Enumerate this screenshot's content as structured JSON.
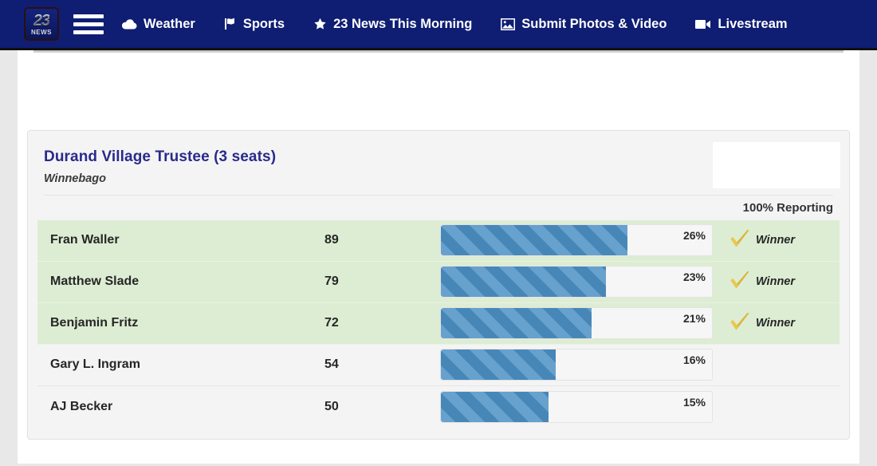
{
  "nav": {
    "logo": {
      "line1": "23",
      "line2": "NEWS",
      "name": "23-news-logo"
    },
    "menu_icon": "hamburger-menu-icon",
    "items": [
      {
        "label": "Weather",
        "icon": "cloud-icon"
      },
      {
        "label": "Sports",
        "icon": "flag-icon"
      },
      {
        "label": "23 News This Morning",
        "icon": "star-icon"
      },
      {
        "label": "Submit Photos & Video",
        "icon": "image-icon"
      },
      {
        "label": "Livestream",
        "icon": "video-camera-icon"
      }
    ]
  },
  "card": {
    "race_title": "Durand Village Trustee (3 seats)",
    "county": "Winnebago",
    "reporting": "100% Reporting",
    "winner_label": "Winner",
    "seats": 3,
    "bar_color": "#4a8fc4",
    "winner_row_color": "#ddedd3",
    "title_color": "#2a2a8c"
  },
  "chart_data": {
    "type": "bar",
    "title": "Durand Village Trustee (3 seats)",
    "subtitle": "Winnebago",
    "annotation": "100% Reporting",
    "xlabel": "",
    "ylabel": "",
    "categories": [
      "Fran Waller",
      "Matthew Slade",
      "Benjamin Fritz",
      "Gary L. Ingram",
      "AJ Becker"
    ],
    "values": [
      89,
      79,
      72,
      54,
      50
    ],
    "percents": [
      26,
      23,
      21,
      16,
      15
    ],
    "winners": [
      true,
      true,
      true,
      false,
      false
    ],
    "rows": [
      {
        "name": "Fran Waller",
        "votes": "89",
        "pct_label": "26%",
        "pct": 26,
        "winner": true,
        "winner_label": "Winner"
      },
      {
        "name": "Matthew Slade",
        "votes": "79",
        "pct_label": "23%",
        "pct": 23,
        "winner": true,
        "winner_label": "Winner"
      },
      {
        "name": "Benjamin Fritz",
        "votes": "72",
        "pct_label": "21%",
        "pct": 21,
        "winner": true,
        "winner_label": "Winner"
      },
      {
        "name": "Gary L. Ingram",
        "votes": "54",
        "pct_label": "16%",
        "pct": 16,
        "winner": false,
        "winner_label": ""
      },
      {
        "name": "AJ Becker",
        "votes": "50",
        "pct_label": "15%",
        "pct": 15,
        "winner": false,
        "winner_label": ""
      }
    ],
    "bar_max_pct": 100,
    "bar_scale_divisor": 38,
    "legend": [],
    "grid": false
  }
}
